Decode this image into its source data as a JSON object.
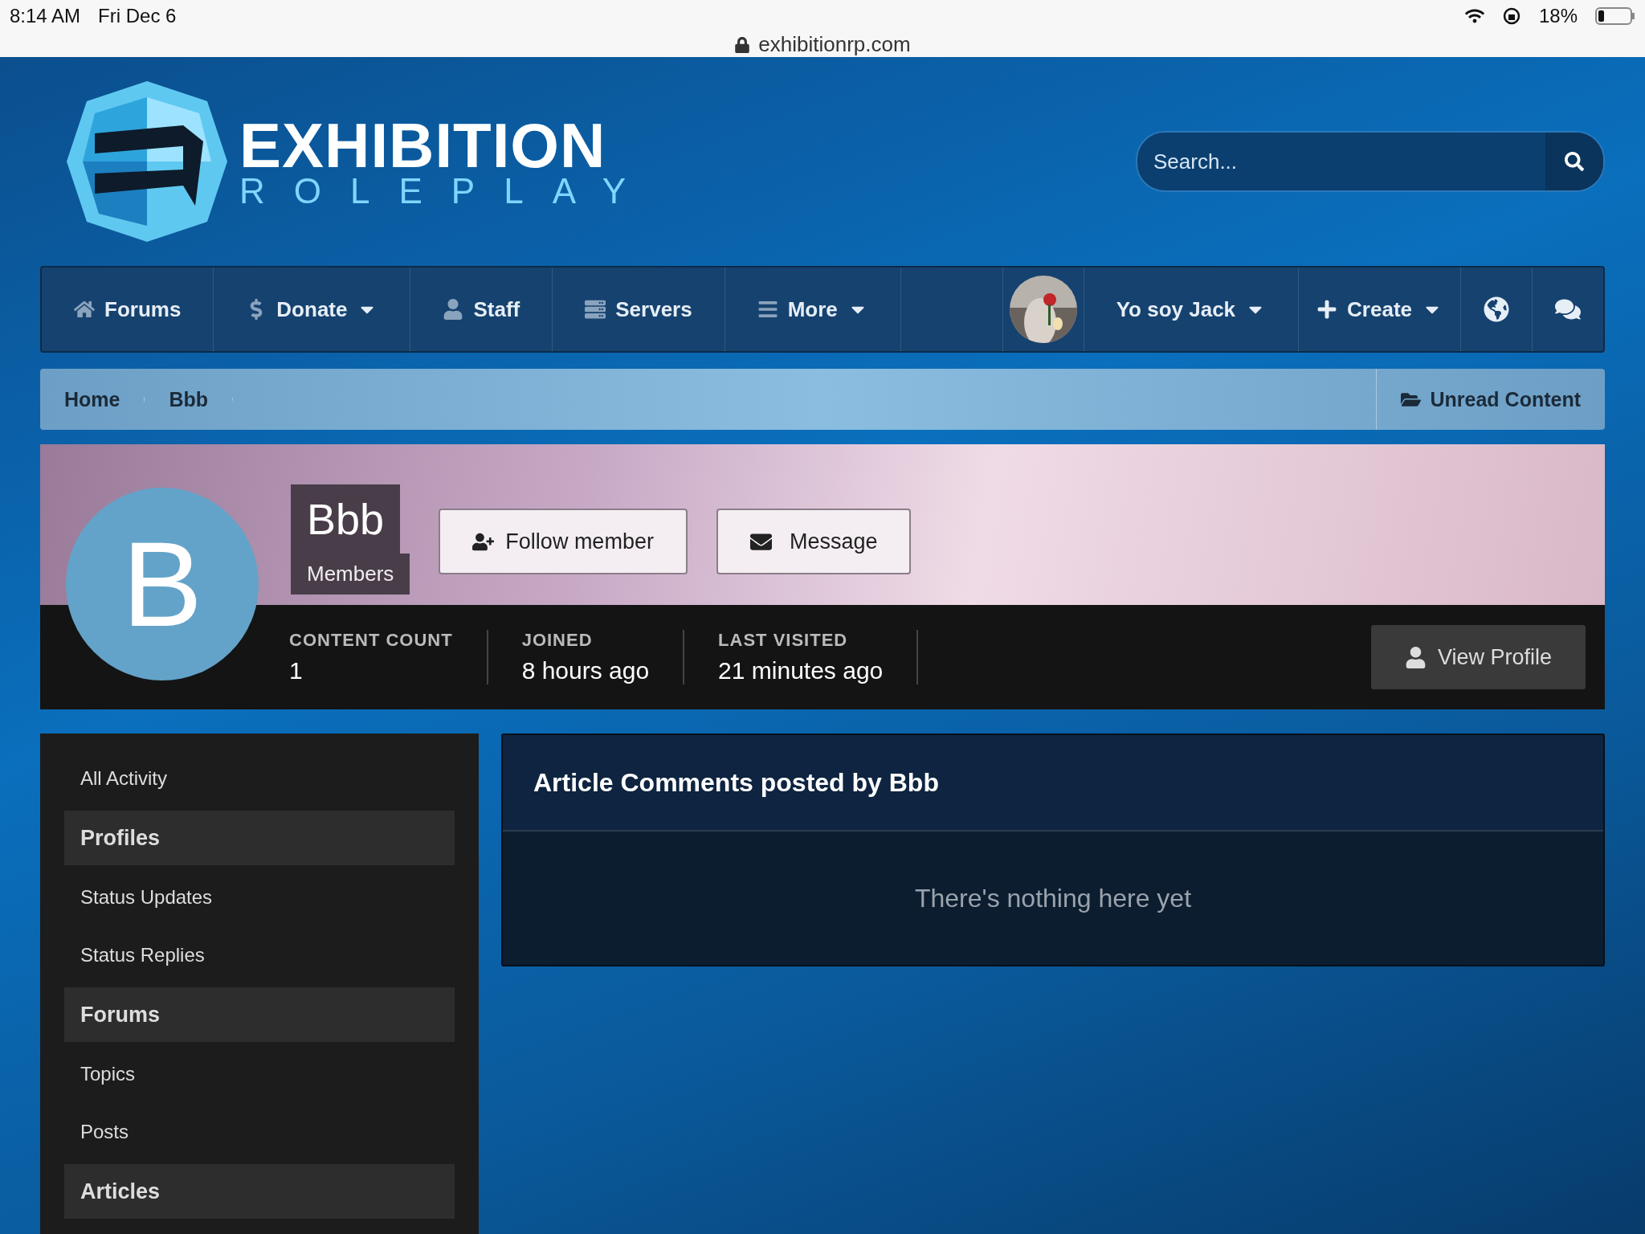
{
  "status_bar": {
    "time": "8:14 AM",
    "date": "Fri Dec 6",
    "battery": "18%",
    "url": "exhibitionrp.com"
  },
  "logo": {
    "title": "EXHIBITION",
    "subtitle": "ROLEPLAY"
  },
  "search": {
    "placeholder": "Search..."
  },
  "nav": {
    "items": [
      {
        "label": "Forums",
        "dropdown": false
      },
      {
        "label": "Donate",
        "dropdown": true
      },
      {
        "label": "Staff",
        "dropdown": false
      },
      {
        "label": "Servers",
        "dropdown": false
      },
      {
        "label": "More",
        "dropdown": true
      }
    ],
    "user": {
      "name": "Yo soy Jack"
    },
    "create": "Create"
  },
  "breadcrumb": {
    "items": [
      "Home",
      "Bbb"
    ],
    "unread": "Unread Content"
  },
  "profile": {
    "initial": "B",
    "name": "Bbb",
    "group": "Members",
    "follow": "Follow member",
    "message": "Message",
    "view_profile": "View Profile",
    "stats": [
      {
        "label": "CONTENT COUNT",
        "value": "1"
      },
      {
        "label": "JOINED",
        "value": "8 hours ago"
      },
      {
        "label": "LAST VISITED",
        "value": "21 minutes ago"
      }
    ]
  },
  "sidebar": {
    "items": [
      {
        "label": "All Activity",
        "kind": "link"
      },
      {
        "label": "Profiles",
        "kind": "header"
      },
      {
        "label": "Status Updates",
        "kind": "link"
      },
      {
        "label": "Status Replies",
        "kind": "link"
      },
      {
        "label": "Forums",
        "kind": "header"
      },
      {
        "label": "Topics",
        "kind": "link"
      },
      {
        "label": "Posts",
        "kind": "link"
      },
      {
        "label": "Articles",
        "kind": "header"
      }
    ]
  },
  "panel": {
    "title": "Article Comments posted by Bbb",
    "empty": "There's nothing here yet"
  }
}
